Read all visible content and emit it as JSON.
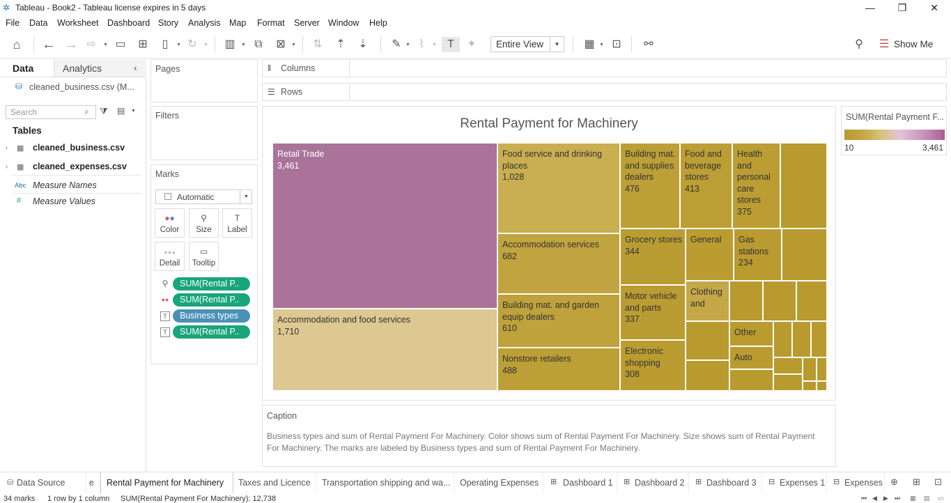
{
  "window": {
    "title": "Tableau - Book2 - Tableau license expires in 5 days"
  },
  "menu": [
    "File",
    "Data",
    "Worksheet",
    "Dashboard",
    "Story",
    "Analysis",
    "Map",
    "Format",
    "Server",
    "Window",
    "Help"
  ],
  "toolbar": {
    "fit_dropdown": "Entire View",
    "show_me": "Show Me"
  },
  "left_panel": {
    "tab_data": "Data",
    "tab_analytics": "Analytics",
    "datasource": "cleaned_business.csv (M...",
    "search_placeholder": "Search",
    "tables_heading": "Tables",
    "tables": [
      "cleaned_business.csv",
      "cleaned_expenses.csv"
    ],
    "fields": [
      {
        "type": "Abc",
        "name": "Measure Names"
      },
      {
        "type": "#",
        "name": "Measure Values"
      }
    ]
  },
  "cards": {
    "pages": "Pages",
    "filters": "Filters",
    "marks": "Marks",
    "mark_type": "Automatic",
    "mark_buttons": [
      "Color",
      "Size",
      "Label",
      "Detail",
      "Tooltip"
    ],
    "pills": [
      {
        "label": "SUM(Rental P..",
        "role": "size"
      },
      {
        "label": "SUM(Rental P..",
        "role": "color"
      },
      {
        "label": "Business types",
        "role": "label"
      },
      {
        "label": "SUM(Rental P..",
        "role": "label"
      }
    ]
  },
  "shelves": {
    "columns": "Columns",
    "rows": "Rows"
  },
  "view": {
    "title": "Rental Payment for  Machinery"
  },
  "chart_data": {
    "type": "treemap",
    "title": "Rental Payment for  Machinery",
    "measure": "SUM(Rental Payment For Machinery)",
    "color_range": [
      10,
      3461
    ],
    "items": [
      {
        "name": "Retail Trade",
        "value": 3461,
        "color": "#aa7399"
      },
      {
        "name": "Accommodation and food services",
        "value": 1710,
        "color": "#ddc891"
      },
      {
        "name": "Food service and drinking places",
        "value": 1028,
        "color": "#c9ae52"
      },
      {
        "name": "Accommodation services",
        "value": 682,
        "color": "#c1a43f"
      },
      {
        "name": "Building mat. and garden equip dealers",
        "value": 610,
        "color": "#bfa23b"
      },
      {
        "name": "Nonstore retailers",
        "value": 488,
        "color": "#bc9f36"
      },
      {
        "name": "Building mat. and supplies dealers",
        "value": 476,
        "color": "#bc9f36"
      },
      {
        "name": "Food and beverage stores",
        "value": 413,
        "color": "#bb9e34"
      },
      {
        "name": "Health and personal care stores",
        "value": 375,
        "color": "#bb9d33"
      },
      {
        "name": "Grocery stores",
        "value": 344,
        "color": "#ba9d32"
      },
      {
        "name": "Motor vehicle and parts",
        "value": 337,
        "color": "#ba9d32"
      },
      {
        "name": "Electronic shopping",
        "value": 308,
        "color": "#ba9c31"
      },
      {
        "name": "General",
        "value": null,
        "color": "#ba9c31"
      },
      {
        "name": "Gas stations",
        "value": 234,
        "color": "#b99b30"
      },
      {
        "name": "Clothing and",
        "value": null,
        "color": "#c4a847"
      },
      {
        "name": "Other",
        "value": null,
        "color": "#b99b30"
      },
      {
        "name": "Auto",
        "value": null,
        "color": "#b99b30"
      }
    ]
  },
  "legend": {
    "title": "SUM(Rental Payment F...",
    "min": "10",
    "max": "3,461"
  },
  "caption": {
    "heading": "Caption",
    "text": "Business types and sum of Rental Payment For Machinery.  Color shows sum of Rental Payment For Machinery.  Size shows sum of Rental Payment For Machinery.  The marks are labeled by Business types and sum of Rental Payment For Machinery."
  },
  "sheet_tabs": [
    "Data Source",
    "e",
    "Rental Payment for  Machinery",
    "Taxes and Licence",
    "Transportation shipping and wa...",
    "Operating Expenses",
    "Dashboard 1",
    "Dashboard 2",
    "Dashboard 3",
    "Expenses 1",
    "Expenses"
  ],
  "status": {
    "marks": "34 marks",
    "rows": "1 row by 1 column",
    "sum": "SUM(Rental Payment For Machinery): 12,738"
  }
}
